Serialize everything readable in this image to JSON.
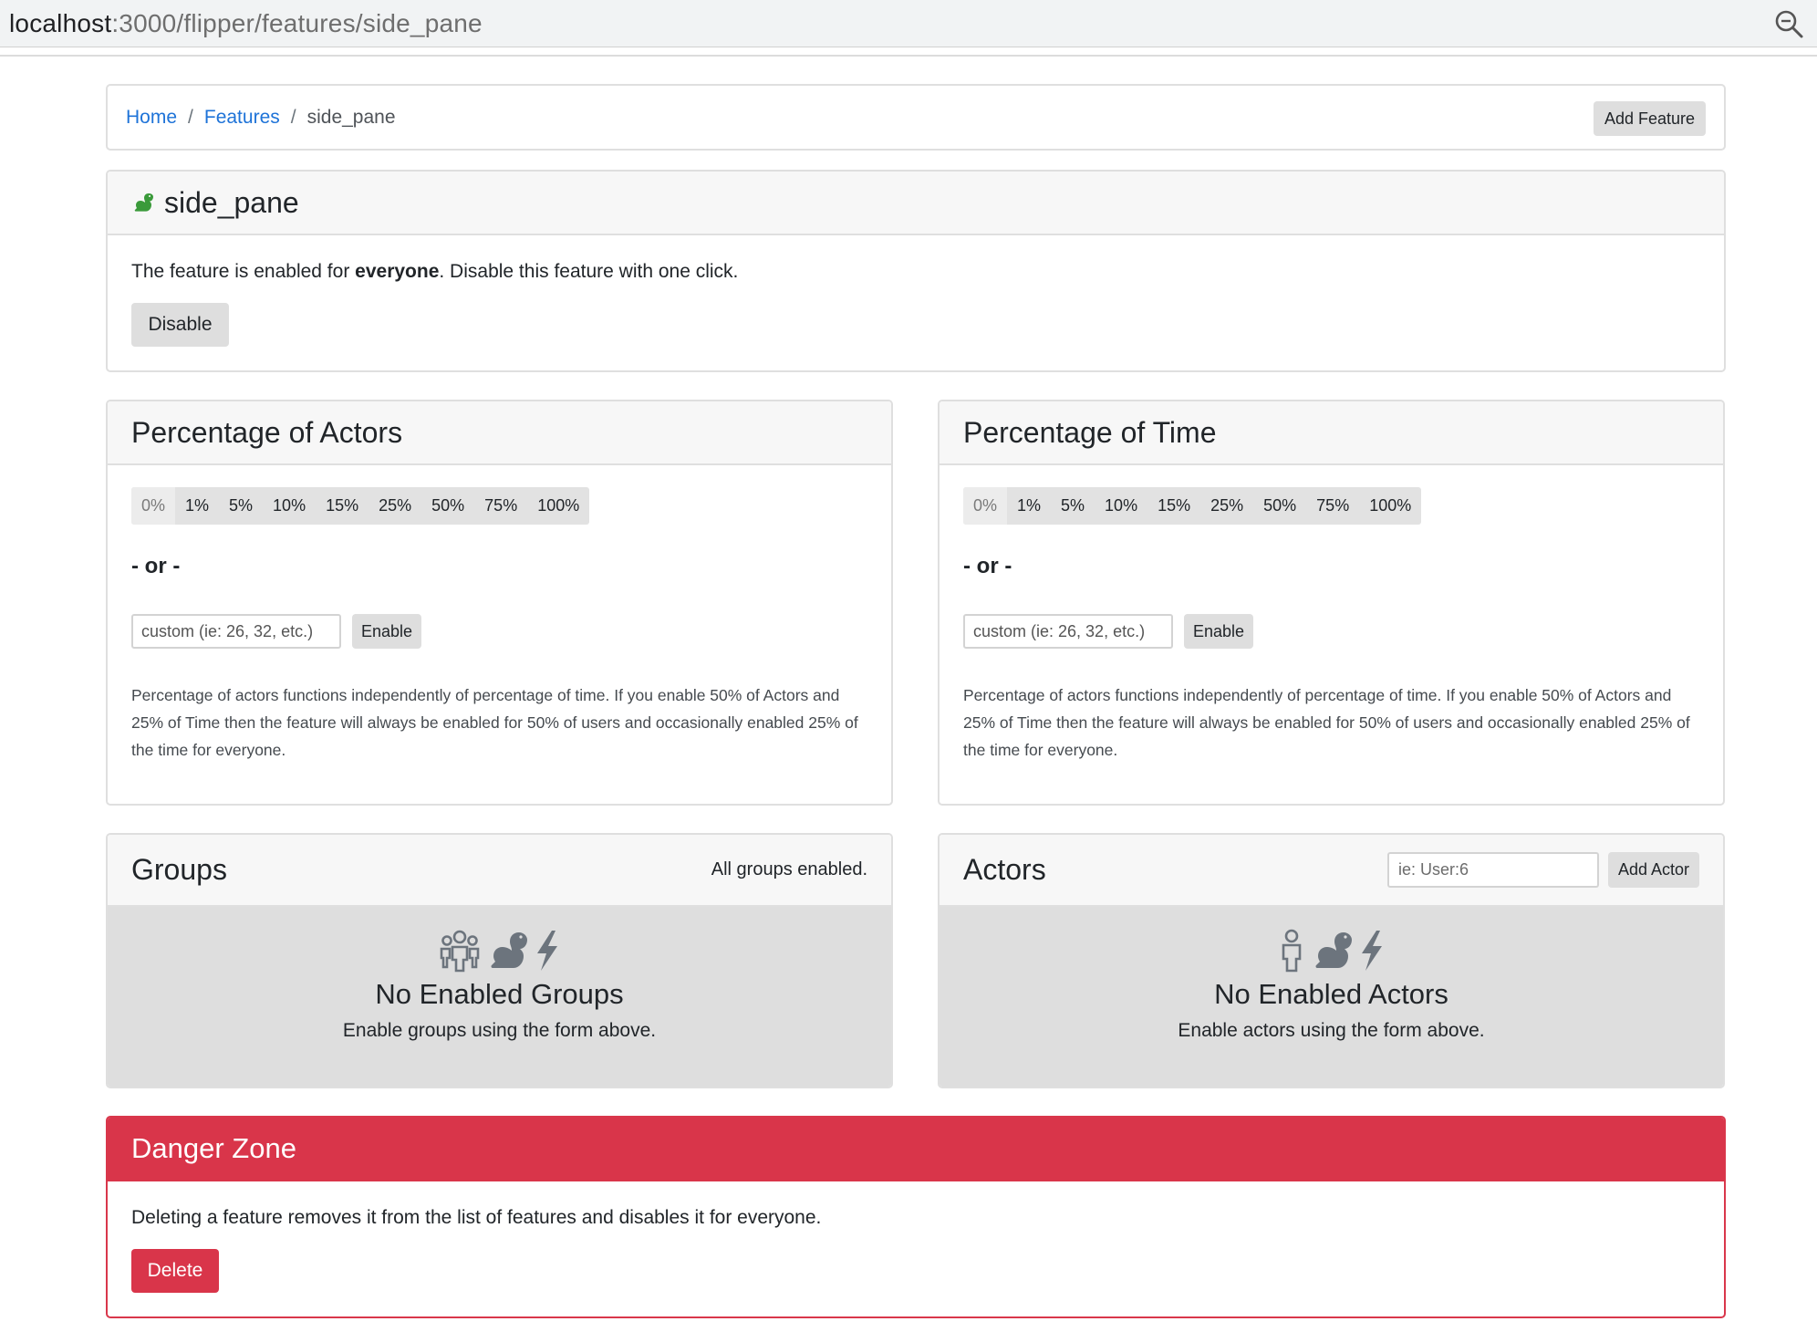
{
  "browser": {
    "url_host": "localhost",
    "url_path": ":3000/flipper/features/side_pane"
  },
  "breadcrumb": {
    "home": "Home",
    "sep1": "/",
    "features": "Features",
    "sep2": "/",
    "current": "side_pane",
    "add_feature_label": "Add Feature"
  },
  "feature": {
    "name": "side_pane",
    "status_prefix": "The feature is enabled for ",
    "status_bold": "everyone",
    "status_suffix": ". Disable this feature with one click.",
    "disable_label": "Disable",
    "status_color": "#3a9a3a"
  },
  "percentage_actors": {
    "title": "Percentage of Actors",
    "options": [
      "0%",
      "1%",
      "5%",
      "10%",
      "15%",
      "25%",
      "50%",
      "75%",
      "100%"
    ],
    "or_text": "- or -",
    "custom_placeholder": "custom (ie: 26, 32, etc.)",
    "enable_label": "Enable",
    "note": "Percentage of actors functions independently of percentage of time. If you enable 50% of Actors and 25% of Time then the feature will always be enabled for 50% of users and occasionally enabled 25% of the time for everyone."
  },
  "percentage_time": {
    "title": "Percentage of Time",
    "options": [
      "0%",
      "1%",
      "5%",
      "10%",
      "15%",
      "25%",
      "50%",
      "75%",
      "100%"
    ],
    "or_text": "- or -",
    "custom_placeholder": "custom (ie: 26, 32, etc.)",
    "enable_label": "Enable",
    "note": "Percentage of actors functions independently of percentage of time. If you enable 50% of Actors and 25% of Time then the feature will always be enabled for 50% of users and occasionally enabled 25% of the time for everyone."
  },
  "groups": {
    "title": "Groups",
    "status": "All groups enabled.",
    "empty_heading": "No Enabled Groups",
    "empty_sub": "Enable groups using the form above."
  },
  "actors": {
    "title": "Actors",
    "input_placeholder": "ie: User:6",
    "add_label": "Add Actor",
    "empty_heading": "No Enabled Actors",
    "empty_sub": "Enable actors using the form above."
  },
  "danger": {
    "title": "Danger Zone",
    "text": "Deleting a feature removes it from the list of features and disables it for everyone.",
    "delete_label": "Delete",
    "color": "#d9354a"
  },
  "icons": {
    "zoom": "zoom-icon",
    "feature_status": "squirrel-icon",
    "groups_empty": [
      "users-icon",
      "squirrel-icon",
      "bolt-icon"
    ],
    "actors_empty": [
      "user-icon",
      "squirrel-icon",
      "bolt-icon"
    ]
  }
}
